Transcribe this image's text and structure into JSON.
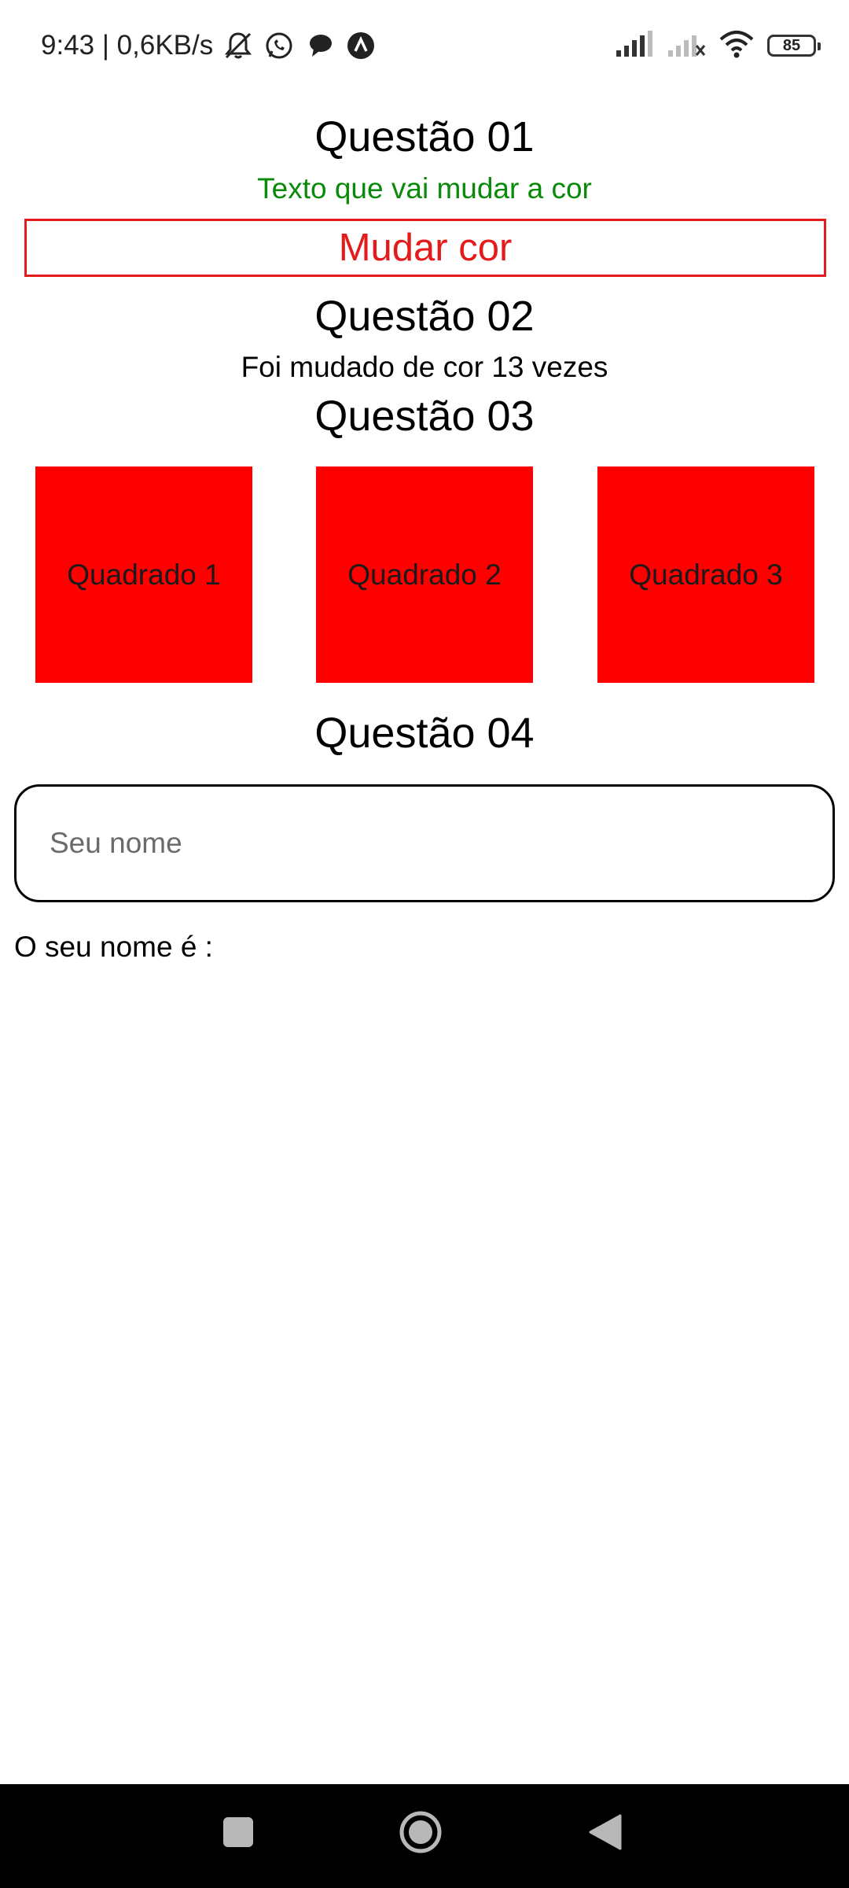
{
  "status_bar": {
    "time_speed": "9:43 | 0,6KB/s",
    "battery_level": "85",
    "icons": [
      "mute-bell-icon",
      "whatsapp-icon",
      "chat-bubble-icon",
      "app-notification-icon",
      "signal-icon",
      "signal-no-sim-icon",
      "wifi-icon",
      "battery-icon"
    ]
  },
  "question1": {
    "title": "Questão 01",
    "color_text": "Texto que vai mudar a cor",
    "button_label": "Mudar cor"
  },
  "question2": {
    "title": "Questão 02",
    "count_text": "Foi mudado de cor 13 vezes"
  },
  "question3": {
    "title": "Questão 03",
    "squares": [
      {
        "label": "Quadrado 1"
      },
      {
        "label": "Quadrado 2"
      },
      {
        "label": "Quadrado 3"
      }
    ]
  },
  "question4": {
    "title": "Questão 04",
    "input_placeholder": "Seu nome",
    "input_value": "",
    "name_label": "O seu nome é :"
  },
  "nav_bar": {
    "icons": [
      "recents-icon",
      "home-icon",
      "back-icon"
    ]
  },
  "colors": {
    "text_green": "#0a8a0a",
    "button_red": "#e31b1b",
    "square_red": "#ff0000",
    "nav_black": "#000000"
  }
}
